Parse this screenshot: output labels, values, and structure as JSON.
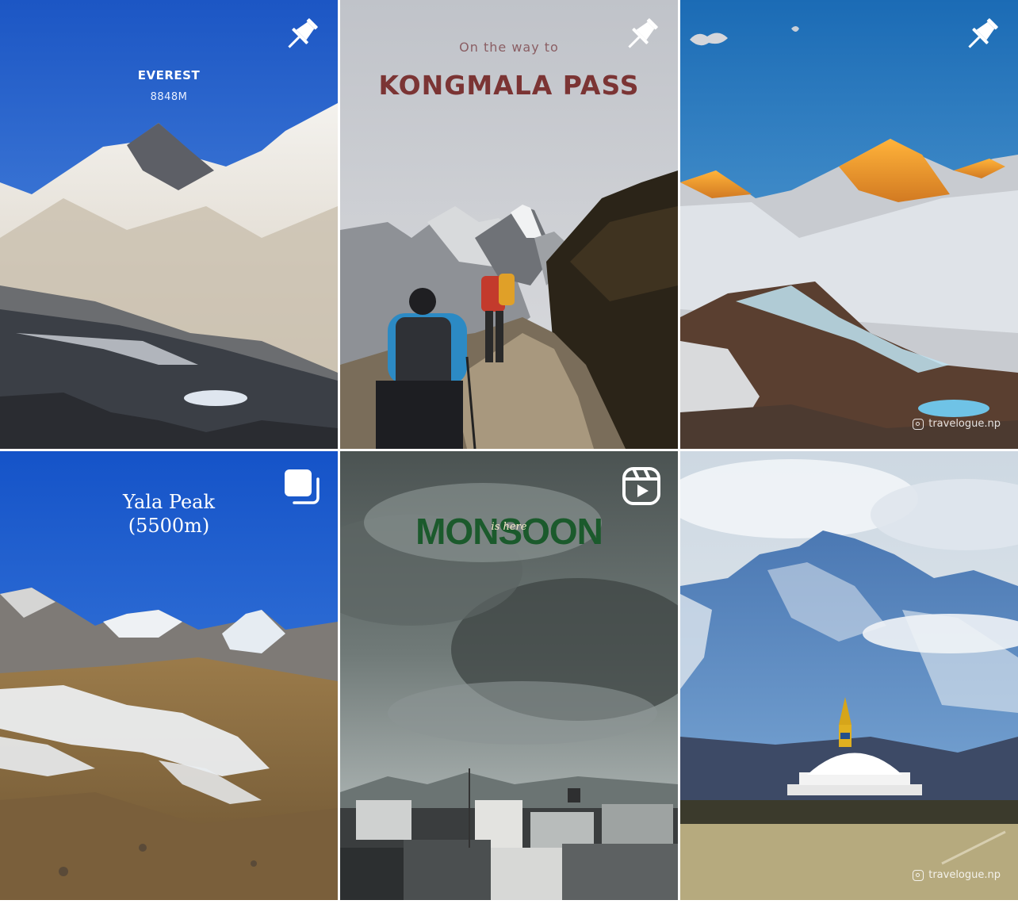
{
  "grid": {
    "tiles": [
      {
        "badge": "pin-icon",
        "title": "EVEREST",
        "subtitle": "8848M"
      },
      {
        "badge": "pin-icon",
        "pretitle": "On the way to",
        "title": "KONGMALA PASS"
      },
      {
        "badge": "pin-icon",
        "watermark": "travelogue.np"
      },
      {
        "badge": "carousel-icon",
        "title_line1": "Yala Peak",
        "title_line2": "(5500m)"
      },
      {
        "badge": "reels-icon",
        "title": "MONSOON",
        "script_word": "is here"
      },
      {
        "watermark": "travelogue.np"
      }
    ]
  },
  "colors": {
    "sky_blue": "#2f66c9",
    "monsoon_green": "#1b5a2c",
    "kongmala_red": "#7b3434"
  }
}
